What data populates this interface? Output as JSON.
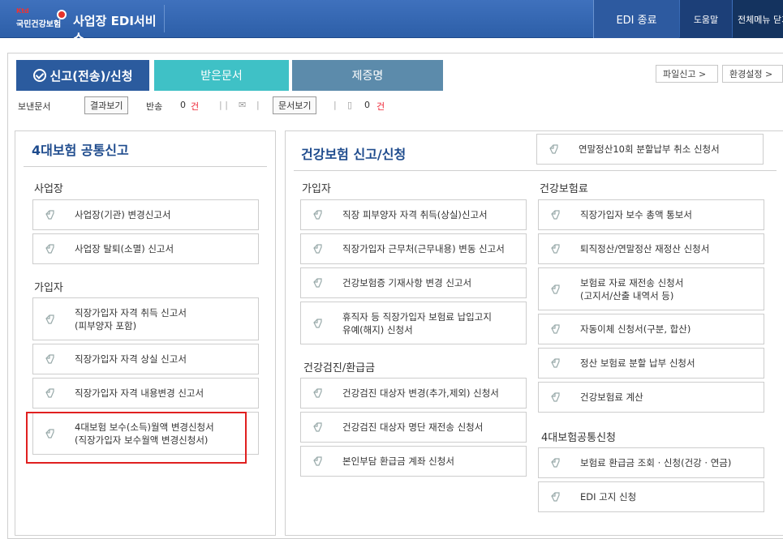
{
  "header": {
    "logo_small": "국민건강보험",
    "logo_brand": "Ktd",
    "service_title": "사업장 EDI서비스",
    "edi_end": "EDI 종료",
    "help": "도움말",
    "all_menu": "전체메뉴 닫기"
  },
  "tabs": [
    {
      "label": "신고(전송)/신청"
    },
    {
      "label": "받은문서"
    },
    {
      "label": "제증명"
    }
  ],
  "right_buttons": {
    "file_report": "파일신고 >",
    "settings": "환경설정 >"
  },
  "toolbar": {
    "sent_docs": "보낸문서",
    "view_result": "결과보기",
    "returned": "반송",
    "returned_count": "0",
    "unit1": "건",
    "view_docs": "문서보기",
    "doc_count": "0",
    "unit2": "건"
  },
  "left_panel": {
    "title": "4대보험 공통신고",
    "sections": [
      {
        "title": "사업장",
        "items": [
          [
            "사업장(기관) 변경신고서"
          ],
          [
            "사업장 탈퇴(소멸) 신고서"
          ]
        ]
      },
      {
        "title": "가입자",
        "items": [
          [
            "직장가입자 자격 취득 신고서",
            "(피부양자 포함)"
          ],
          [
            "직장가입자 자격 상실 신고서"
          ],
          [
            "직장가입자 자격 내용변경 신고서"
          ],
          [
            "4대보험 보수(소득)월액 변경신청서",
            "(직장가입자 보수월액 변경신청서)"
          ]
        ]
      }
    ]
  },
  "right_panel": {
    "title": "건강보험 신고/신청",
    "top_item": [
      "연말정산10회 분할납부 취소 신청서"
    ],
    "col1": [
      {
        "title": "가입자",
        "items": [
          [
            "직장 피부양자 자격 취득(상실)신고서"
          ],
          [
            "직장가입자 근무처(근무내용) 변동 신고서"
          ],
          [
            "건강보험증 기재사항 변경 신고서"
          ],
          [
            "휴직자 등 직장가입자 보험료 납입고지",
            "유예(해지) 신청서"
          ]
        ]
      },
      {
        "title": "건강검진/환급금",
        "items": [
          [
            "건강검진 대상자 변경(추가,제외) 신청서"
          ],
          [
            "건강검진 대상자 명단 재전송 신청서"
          ],
          [
            "본인부담 환급금 계좌 신청서"
          ]
        ]
      }
    ],
    "col2": [
      {
        "title": "건강보험료",
        "items": [
          [
            "직장가입자 보수 총액 통보서"
          ],
          [
            "퇴직정산/연말정산 재정산 신청서"
          ],
          [
            "보험료 자료 재전송 신청서",
            "(고지서/산출 내역서 등)"
          ],
          [
            "자동이체 신청서(구분, 합산)"
          ],
          [
            "정산 보험료 분할 납부 신청서"
          ],
          [
            "건강보험료 계산"
          ]
        ]
      },
      {
        "title": "4대보험공통신청",
        "items": [
          [
            "보험료 환급금 조회 · 신청(건강 · 연금)"
          ],
          [
            "EDI 고지 신청"
          ]
        ]
      }
    ]
  },
  "colors": {
    "header_blue": "#2d5fa8",
    "tab_active": "#2b5b9e",
    "tab_teal": "#3fc1c6",
    "tab_steel": "#5c8bab",
    "title_blue": "#1e4b8d",
    "highlight_red": "#e02020"
  }
}
